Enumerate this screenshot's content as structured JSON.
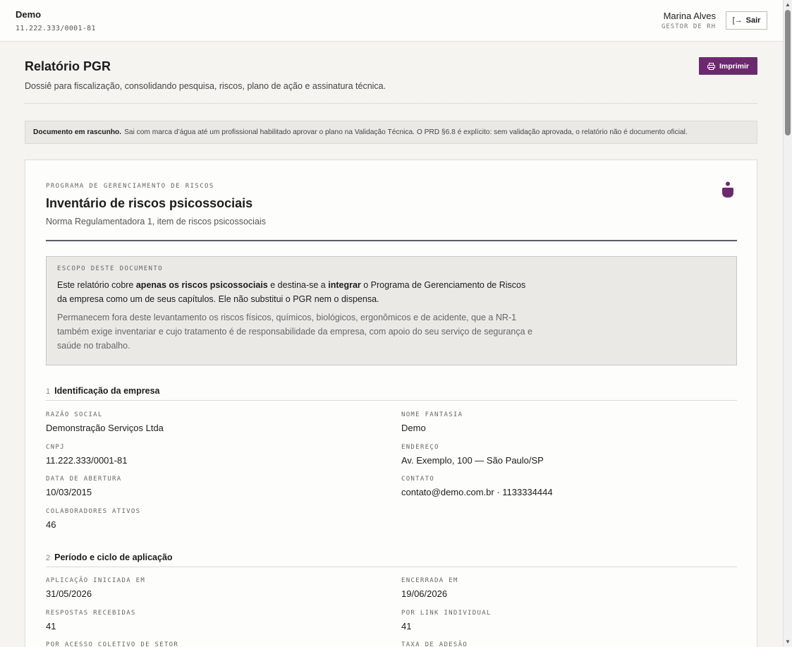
{
  "topbar": {
    "company_name": "Demo",
    "company_cnpj": "11.222.333/0001-81",
    "user_name": "Marina Alves",
    "user_role": "GESTOR DE RH",
    "logout_label": "Sair",
    "logout_icon": "logout-icon"
  },
  "page": {
    "title": "Relatório PGR",
    "subtitle": "Dossiê para fiscalização, consolidando pesquisa, riscos, plano de ação e assinatura técnica.",
    "print_label": "Imprimir",
    "print_icon": "printer-icon"
  },
  "draft_notice": {
    "strong": "Documento em rascunho.",
    "text": "Sai com marca d’água até um profissional habilitado aprovar o plano na Validação Técnica. O PRD §6.8 é explícito: sem validação aprovada, o relatório não é documento oficial."
  },
  "document": {
    "kicker": "PROGRAMA DE GERENCIAMENTO DE RISCOS",
    "title": "Inventário de riscos psicossociais",
    "subtitle": "Norma Regulamentadora 1, item de riscos psicossociais",
    "brand_color": "#6b2a6e",
    "scope": {
      "kicker": "ESCOPO DESTE DOCUMENTO",
      "p1_a": "Este relatório cobre ",
      "p1_b": "apenas os riscos psicossociais",
      "p1_c": " e destina-se a ",
      "p1_d": "integrar",
      "p1_e": " o Programa de Gerenciamento de Riscos da empresa como um de seus capítulos. Ele não substitui o PGR nem o dispensa.",
      "p2": "Permanecem fora deste levantamento os riscos físicos, químicos, biológicos, ergonômicos e de acidente, que a NR-1 também exige inventariar e cujo tratamento é de responsabilidade da empresa, com apoio do seu serviço de segurança e saúde no trabalho."
    },
    "section1": {
      "number": "1",
      "title": "Identificação da empresa",
      "fields": [
        {
          "label": "RAZÃO SOCIAL",
          "value": "Demonstração Serviços Ltda"
        },
        {
          "label": "NOME FANTASIA",
          "value": "Demo"
        },
        {
          "label": "CNPJ",
          "value": "11.222.333/0001-81"
        },
        {
          "label": "ENDEREÇO",
          "value": "Av. Exemplo, 100 — São Paulo/SP"
        },
        {
          "label": "DATA DE ABERTURA",
          "value": "10/03/2015"
        },
        {
          "label": "CONTATO",
          "value": "contato@demo.com.br · 1133334444"
        },
        {
          "label": "COLABORADORES ATIVOS",
          "value": "46"
        }
      ]
    },
    "section2": {
      "number": "2",
      "title": "Período e ciclo de aplicação",
      "fields": [
        {
          "label": "APLICAÇÃO INICIADA EM",
          "value": "31/05/2026"
        },
        {
          "label": "ENCERRADA EM",
          "value": "19/06/2026"
        },
        {
          "label": "RESPOSTAS RECEBIDAS",
          "value": "41"
        },
        {
          "label": "POR LINK INDIVIDUAL",
          "value": "41"
        },
        {
          "label": "POR ACESSO COLETIVO DE SETOR",
          "value": ""
        },
        {
          "label": "TAXA DE ADESÃO",
          "value": ""
        }
      ]
    }
  }
}
